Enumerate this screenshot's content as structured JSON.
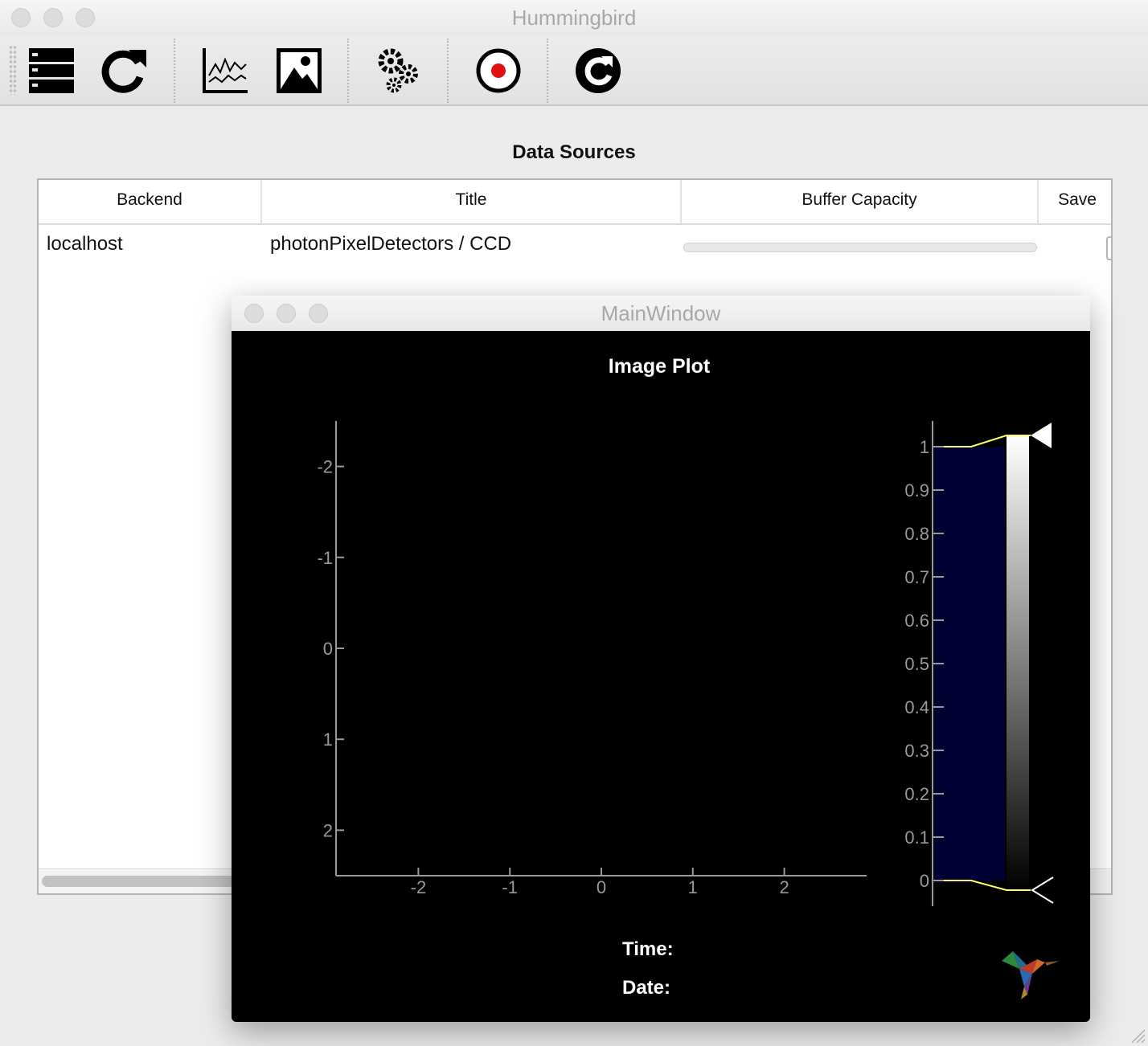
{
  "app": {
    "title": "Hummingbird"
  },
  "toolbar": {
    "buttons": [
      {
        "name": "data-sources-icon"
      },
      {
        "name": "reload-icon"
      },
      {
        "name": "line-plot-icon"
      },
      {
        "name": "image-plot-icon"
      },
      {
        "name": "settings-icon"
      },
      {
        "name": "record-icon"
      },
      {
        "name": "refresh-icon"
      }
    ]
  },
  "data_sources": {
    "title": "Data Sources",
    "columns": [
      "Backend",
      "Title",
      "Buffer Capacity",
      "Save"
    ],
    "rows": [
      {
        "backend": "localhost",
        "title": "photonPixelDetectors / CCD",
        "buffer_fill": 0,
        "save": false
      }
    ]
  },
  "main_window": {
    "title": "MainWindow",
    "plot": {
      "title": "Image Plot",
      "time_label": "Time:",
      "date_label": "Date:"
    }
  },
  "chart_data": {
    "type": "heatmap",
    "title": "Image Plot",
    "xlabel": "",
    "ylabel": "",
    "x_ticks": [
      "-2",
      "-1",
      "0",
      "1",
      "2"
    ],
    "y_ticks": [
      "-2",
      "-1",
      "0",
      "1",
      "2"
    ],
    "xlim": [
      -2.9,
      2.9
    ],
    "ylim": [
      2.5,
      -2.5
    ],
    "values": [],
    "colorbar": {
      "ticks": [
        "0",
        "0.1",
        "0.2",
        "0.3",
        "0.4",
        "0.5",
        "0.6",
        "0.7",
        "0.8",
        "0.9",
        "1"
      ],
      "range": [
        0,
        1
      ],
      "histogram_color": "#000033",
      "gradient": [
        "#000000",
        "#ffffff"
      ],
      "marker_color": "#ffff66"
    }
  }
}
